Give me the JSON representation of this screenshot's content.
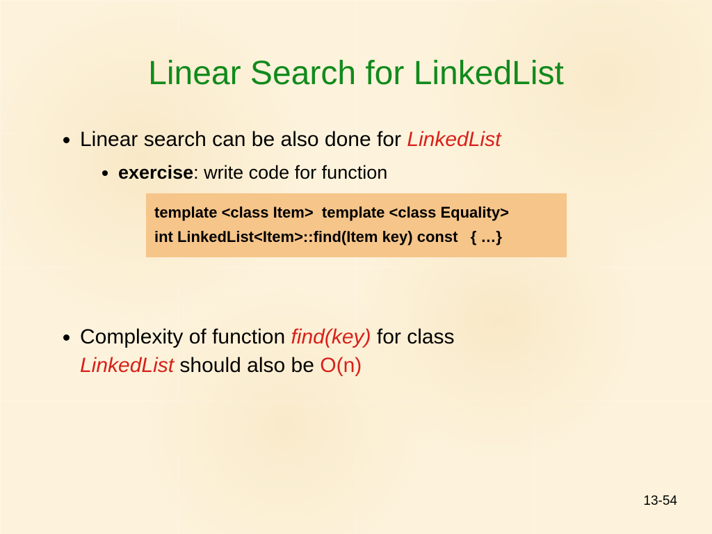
{
  "title": "Linear Search for LinkedList",
  "bullet1": {
    "prefix": "Linear search can be also done for ",
    "emph": "LinkedList",
    "sub": {
      "bold": "exercise",
      "rest": ": write code for function"
    }
  },
  "code": {
    "line1": "template <class Item>  template <class Equality>",
    "line2": "int LinkedList<Item>::find(Item key) const   { …}"
  },
  "bullet2": {
    "p1": "Complexity of function ",
    "fn": "find(key)",
    "p2": " for class ",
    "cls": "LinkedList",
    "p3": " should also be ",
    "bigO": "O(n)"
  },
  "slideNumber": "13-54"
}
